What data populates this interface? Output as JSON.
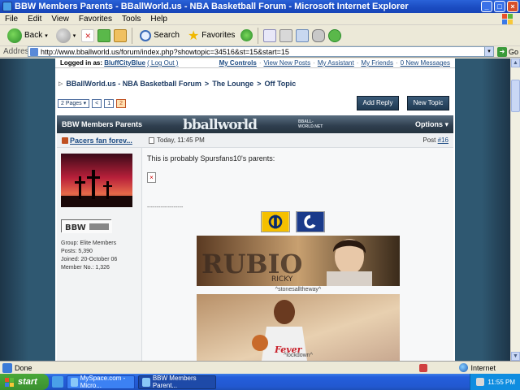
{
  "window": {
    "title": "BBW Members Parents - BBallWorld.us - NBA Basketball Forum - Microsoft Internet Explorer"
  },
  "menu": [
    "File",
    "Edit",
    "View",
    "Favorites",
    "Tools",
    "Help"
  ],
  "toolbar": {
    "back": "Back",
    "search": "Search",
    "favorites": "Favorites"
  },
  "address": {
    "label": "Address",
    "url": "http://www.bballworld.us/forum/index.php?showtopic=34516&st=15&start=15",
    "go": "Go"
  },
  "userbar": {
    "logged_in_as": "Logged in as:",
    "username": "BluffCityBlue",
    "logout": "( Log Out )",
    "links": [
      "My Controls",
      "View New Posts",
      "My Assistant",
      "My Friends",
      "0 New Messages"
    ],
    "sep": "·"
  },
  "breadcrumb": {
    "items": [
      "BBallWorld.us - NBA Basketball Forum",
      "The Lounge",
      "Off Topic"
    ],
    "sep": ">"
  },
  "pager": {
    "label": "2 Pages",
    "prev": "<",
    "page1": "1",
    "page2": "2"
  },
  "buttons": {
    "add_reply": "Add Reply",
    "new_topic": "New Topic"
  },
  "topic": {
    "title": "BBW Members Parents",
    "options": "Options",
    "logo_text": "bballworld",
    "logo_small": "BBALL-WORLD.NET"
  },
  "post": {
    "author": "Pacers fan forev...",
    "date": "Today, 11:45 PM",
    "post_label": "Post",
    "post_number": "#16",
    "text": "This is probably Spursfans10's parents:",
    "sig_line": "-------------------",
    "banner1_text": "RUBIO",
    "banner1_sub": "RICKY",
    "caption1": "^stonesalltheway^",
    "banner2_text": "Fever",
    "caption2": "^lockdown^"
  },
  "member": {
    "group": "Group: Elite Members",
    "posts": "Posts: 5,390",
    "joined": "Joined: 20-October 06",
    "member_no": "Member No.: 1,326",
    "badge_text": "BBW"
  },
  "status": {
    "left": "Done",
    "zone": "Internet"
  },
  "taskbar": {
    "start": "start",
    "task1": "MySpace.com - Micro...",
    "task2": "BBW Members Parent...",
    "clock": "11:55 PM"
  },
  "colors": {
    "titlebar": "#1a4bc0",
    "page_bg": "#2f5871",
    "link": "#1c4a82",
    "header_dark": "#2e3e4e"
  }
}
